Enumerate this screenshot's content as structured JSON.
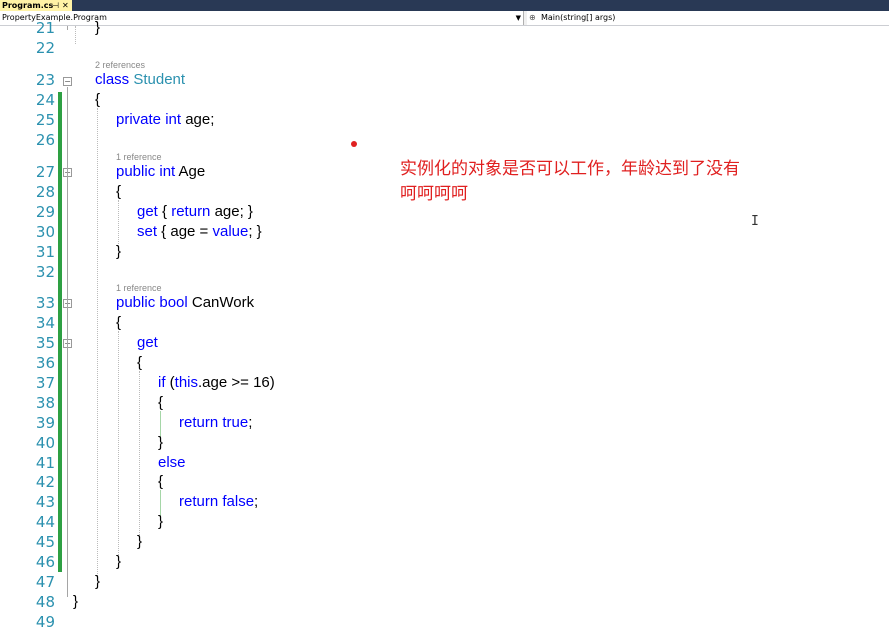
{
  "tab": {
    "title": "Program.cs",
    "pin": "⊣",
    "close": "✕"
  },
  "nav": {
    "class_path": "PropertyExample.Program",
    "member": "Main(string[] args)",
    "member_icon": "method-icon"
  },
  "refs": {
    "student": "2 references",
    "age": "1 reference",
    "canwork": "1 reference"
  },
  "line_numbers": [
    "21",
    "22",
    "23",
    "24",
    "25",
    "26",
    "27",
    "28",
    "29",
    "30",
    "31",
    "32",
    "33",
    "34",
    "35",
    "36",
    "37",
    "38",
    "39",
    "40",
    "41",
    "42",
    "43",
    "44",
    "45",
    "46",
    "47",
    "48",
    "49"
  ],
  "code": {
    "l21": "}",
    "l23_kw": "class",
    "l23_type": "Student",
    "l24": "{",
    "l25_kw": "private int",
    "l25_rest": " age;",
    "l27_kw": "public int",
    "l27_rest": " Age",
    "l28": "{",
    "l29_kw1": "get",
    "l29_p1": " { ",
    "l29_kw2": "return",
    "l29_p2": " age; }",
    "l30_kw1": "set",
    "l30_p1": " { age = ",
    "l30_kw2": "value",
    "l30_p2": "; }",
    "l31": "}",
    "l33_kw": "public bool",
    "l33_rest": " CanWork",
    "l34": "{",
    "l35_kw": "get",
    "l36": "{",
    "l37_kw1": "if",
    "l37_p1": " (",
    "l37_kw2": "this",
    "l37_p2": ".age >= 16)",
    "l38": "{",
    "l39_kw": "return true",
    "l39_p": ";",
    "l40": "}",
    "l41_kw": "else",
    "l42": "{",
    "l43_kw": "return false",
    "l43_p": ";",
    "l44": "}",
    "l45": "}",
    "l46": "}",
    "l47": "}",
    "l48": "}"
  },
  "annotation": {
    "line1": "实例化的对象是否可以工作，年龄达到了没有",
    "line2": "呵呵呵呵"
  },
  "colors": {
    "keyword": "#0000ff",
    "type": "#2b91af",
    "line_number": "#2b91af",
    "change_bar": "#2ea043",
    "annotation": "#e02020"
  }
}
